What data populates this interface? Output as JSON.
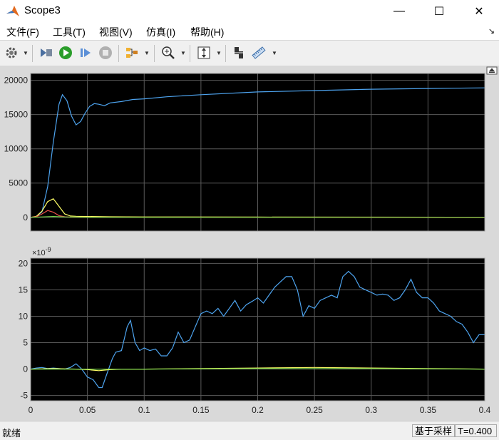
{
  "window": {
    "title": "Scope3",
    "minimize": "—",
    "maximize": "☐",
    "close": "✕"
  },
  "menu": [
    {
      "label": "文件(F)"
    },
    {
      "label": "工具(T)"
    },
    {
      "label": "视图(V)"
    },
    {
      "label": "仿真(I)"
    },
    {
      "label": "帮助(H)"
    }
  ],
  "toolbar": {
    "icons": [
      "settings-icon",
      "restore-icon",
      "run-icon",
      "step-forward-icon",
      "stop-icon",
      "highlight-block-icon",
      "zoom-in-icon",
      "autoscale-icon",
      "cursor-measurement-icon",
      "signal-statistics-icon"
    ]
  },
  "colors": {
    "plot_bg": "#000000",
    "grid": "#5a5a5a",
    "series_blue": "#4da3ee",
    "series_yellow": "#ffff66",
    "series_red": "#e8504a",
    "series_green": "#7ad44a"
  },
  "chart_data": [
    {
      "type": "line",
      "title": "",
      "xlim": [
        0,
        0.4
      ],
      "ylim": [
        -2000,
        21000
      ],
      "yticks": [
        0,
        5000,
        10000,
        15000,
        20000
      ],
      "ytick_labels": [
        "0",
        "5000",
        "10000",
        "15000",
        "20000"
      ],
      "series": [
        {
          "color": "#4da3ee",
          "x": [
            0,
            0.005,
            0.01,
            0.015,
            0.02,
            0.025,
            0.028,
            0.032,
            0.036,
            0.04,
            0.044,
            0.048,
            0.052,
            0.056,
            0.06,
            0.065,
            0.07,
            0.08,
            0.09,
            0.1,
            0.12,
            0.15,
            0.2,
            0.25,
            0.3,
            0.35,
            0.4
          ],
          "y": [
            0,
            100,
            800,
            4500,
            11000,
            16500,
            17900,
            17000,
            14800,
            13500,
            14000,
            15200,
            16200,
            16600,
            16500,
            16300,
            16700,
            16900,
            17200,
            17300,
            17600,
            17900,
            18300,
            18500,
            18700,
            18800,
            18900
          ]
        },
        {
          "color": "#ffff66",
          "x": [
            0,
            0.005,
            0.01,
            0.015,
            0.02,
            0.025,
            0.03,
            0.035,
            0.04,
            0.05,
            0.07,
            0.1,
            0.2,
            0.3,
            0.4
          ],
          "y": [
            0,
            150,
            900,
            2300,
            2700,
            1600,
            500,
            200,
            150,
            120,
            80,
            60,
            40,
            30,
            20
          ]
        },
        {
          "color": "#e8504a",
          "x": [
            0,
            0.005,
            0.01,
            0.015,
            0.02,
            0.025,
            0.03,
            0.035,
            0.04,
            0.05,
            0.4
          ],
          "y": [
            0,
            80,
            500,
            1000,
            750,
            250,
            80,
            30,
            10,
            0,
            0
          ]
        },
        {
          "color": "#7ad44a",
          "x": [
            0,
            0.01,
            0.02,
            0.03,
            0.05,
            0.4
          ],
          "y": [
            0,
            60,
            120,
            60,
            20,
            10
          ]
        }
      ]
    },
    {
      "type": "line",
      "title": "",
      "multiplier": "×10",
      "multiplier_exp": "-9",
      "xlim": [
        0,
        0.4
      ],
      "ylim": [
        -6,
        21
      ],
      "yticks": [
        -5,
        0,
        5,
        10,
        15,
        20
      ],
      "ytick_labels": [
        "-5",
        "0",
        "5",
        "10",
        "15",
        "20"
      ],
      "xticks": [
        0,
        0.05,
        0.1,
        0.15,
        0.2,
        0.25,
        0.3,
        0.35,
        0.4
      ],
      "xtick_labels": [
        "0",
        "0.05",
        "0.1",
        "0.15",
        "0.2",
        "0.25",
        "0.3",
        "0.35",
        "0.4"
      ],
      "series": [
        {
          "color": "#4da3ee",
          "x": [
            0,
            0.005,
            0.01,
            0.015,
            0.02,
            0.025,
            0.03,
            0.035,
            0.04,
            0.045,
            0.05,
            0.055,
            0.06,
            0.063,
            0.067,
            0.072,
            0.075,
            0.08,
            0.085,
            0.088,
            0.092,
            0.096,
            0.1,
            0.105,
            0.11,
            0.115,
            0.12,
            0.125,
            0.13,
            0.135,
            0.14,
            0.145,
            0.15,
            0.155,
            0.16,
            0.165,
            0.17,
            0.175,
            0.18,
            0.185,
            0.19,
            0.195,
            0.2,
            0.205,
            0.21,
            0.215,
            0.22,
            0.225,
            0.23,
            0.235,
            0.24,
            0.245,
            0.25,
            0.255,
            0.26,
            0.265,
            0.27,
            0.275,
            0.28,
            0.285,
            0.29,
            0.295,
            0.3,
            0.305,
            0.31,
            0.315,
            0.32,
            0.325,
            0.33,
            0.335,
            0.34,
            0.345,
            0.35,
            0.355,
            0.36,
            0.365,
            0.37,
            0.375,
            0.38,
            0.385,
            0.39,
            0.395,
            0.4
          ],
          "y": [
            0,
            0.2,
            0.3,
            0.1,
            0.2,
            0.1,
            0,
            0.3,
            1,
            0,
            -1.5,
            -2,
            -3.5,
            -3.5,
            -1,
            2,
            3.2,
            3.5,
            8,
            9.2,
            5,
            3.5,
            4,
            3.5,
            3.8,
            2.5,
            2.5,
            4,
            7,
            5,
            5.5,
            8,
            10.5,
            11,
            10.5,
            11.5,
            10,
            11.5,
            13,
            11,
            12.2,
            12.8,
            13.5,
            12.5,
            14,
            15.5,
            16.5,
            17.5,
            17.5,
            15,
            10,
            12,
            11.5,
            13,
            13.5,
            14,
            13.5,
            17.5,
            18.5,
            17.5,
            15.5,
            15,
            14.5,
            14,
            14.2,
            14,
            13,
            13.5,
            15,
            17,
            14.5,
            13.5,
            13.5,
            12.5,
            11,
            10.5,
            10,
            9,
            8.5,
            7,
            5,
            6.5,
            6.5
          ]
        },
        {
          "color": "#ffff66",
          "x": [
            0,
            0.02,
            0.04,
            0.05,
            0.06,
            0.07,
            0.08,
            0.1,
            0.15,
            0.2,
            0.25,
            0.3,
            0.35,
            0.4
          ],
          "y": [
            0,
            0.1,
            0,
            -0.1,
            -0.3,
            -0.1,
            0,
            0,
            0.1,
            0.2,
            0.3,
            0.2,
            0.1,
            0
          ]
        },
        {
          "color": "#7ad44a",
          "x": [
            0,
            0.05,
            0.1,
            0.2,
            0.3,
            0.4
          ],
          "y": [
            0,
            0,
            0,
            0.1,
            0.1,
            0
          ]
        }
      ]
    }
  ],
  "status": {
    "left": "就绪",
    "mode": "基于采样",
    "time": "T=0.400"
  }
}
